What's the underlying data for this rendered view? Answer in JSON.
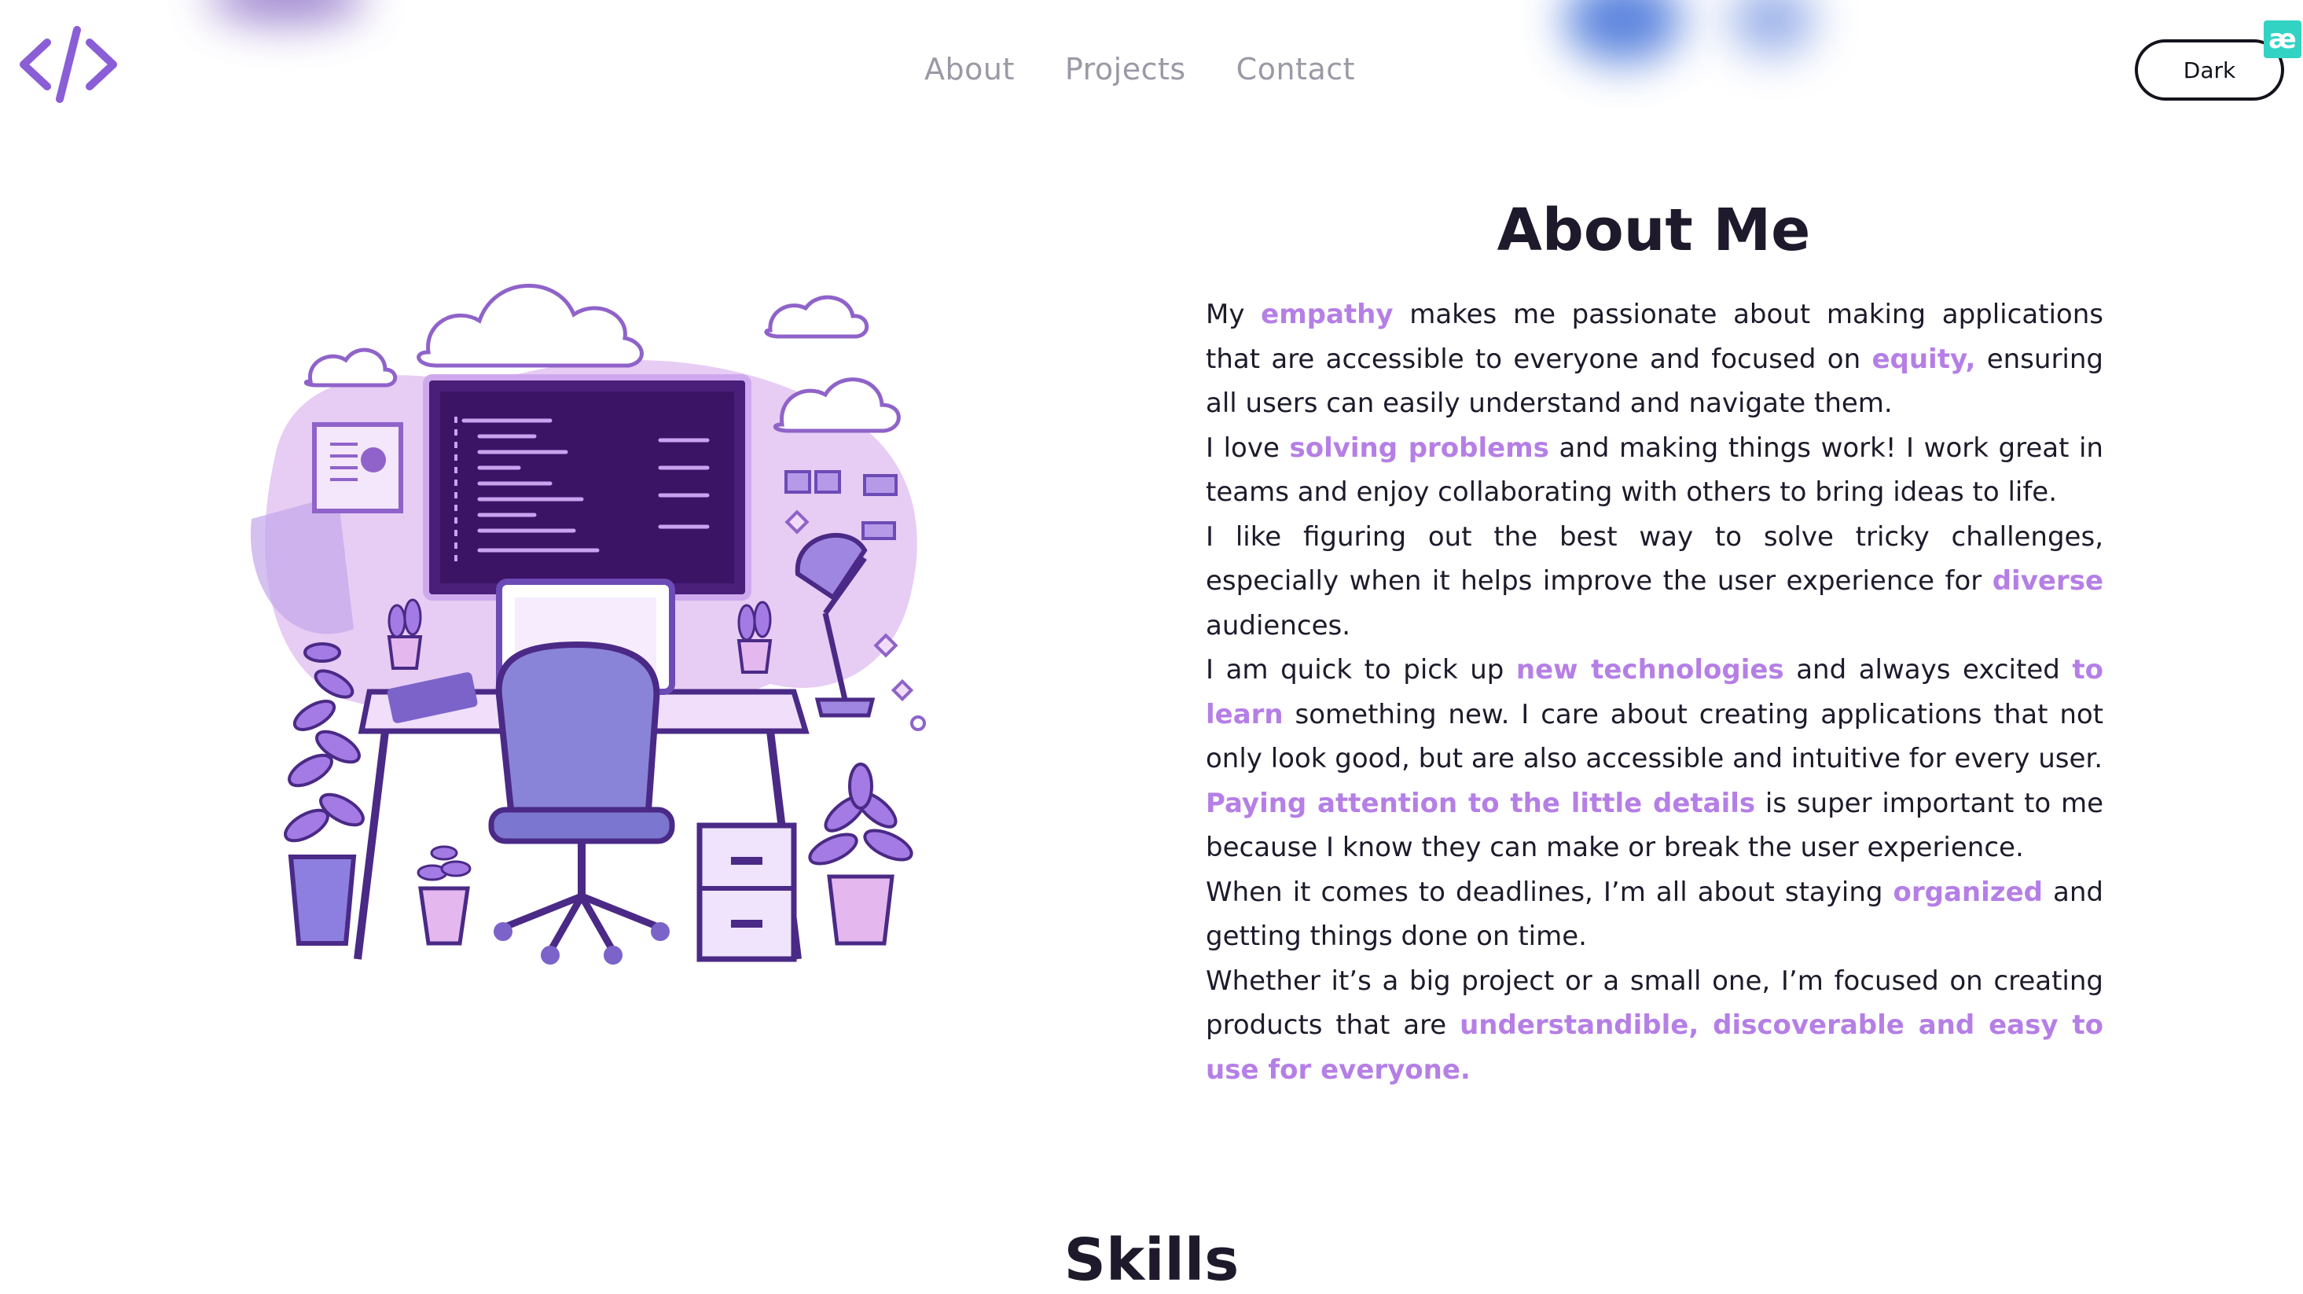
{
  "nav": {
    "links": [
      "About",
      "Projects",
      "Contact"
    ]
  },
  "theme_toggle": {
    "label": "Dark"
  },
  "badge": {
    "text": "æ"
  },
  "about": {
    "title": "About Me",
    "paragraphs": [
      [
        {
          "t": "My "
        },
        {
          "t": "empathy",
          "h": true
        },
        {
          "t": " makes me passionate about making applications that are accessible to everyone and focused on "
        },
        {
          "t": "equity,",
          "h": true
        },
        {
          "t": " ensuring all users can easily understand and navigate them."
        }
      ],
      [
        {
          "t": "I love "
        },
        {
          "t": "solving problems",
          "h": true
        },
        {
          "t": " and making things work! I work great in teams and enjoy collaborating with others to bring ideas to life."
        }
      ],
      [
        {
          "t": "I like figuring out the best way to solve tricky challenges, especially when it helps improve the user experience for "
        },
        {
          "t": "diverse",
          "h": true
        },
        {
          "t": " audiences."
        }
      ],
      [
        {
          "t": "I am quick to pick up "
        },
        {
          "t": "new technologies",
          "h": true
        },
        {
          "t": " and always excited "
        },
        {
          "t": "to learn",
          "h": true
        },
        {
          "t": " something new. I care about creating applications that not only look good, but are also accessible and intuitive for every user."
        }
      ],
      [
        {
          "t": "Paying attention to the little details",
          "h": true
        },
        {
          "t": " is super important to me because I know they can make or break the user experience."
        }
      ],
      [
        {
          "t": "When it comes to deadlines, I’m all about staying "
        },
        {
          "t": "organized",
          "h": true
        },
        {
          "t": " and getting things done on time."
        }
      ],
      [
        {
          "t": "Whether it’s a big project or a small one, I’m focused on creating products that are "
        },
        {
          "t": "understandible, discoverable and easy to use for everyone.",
          "h": true
        }
      ]
    ]
  },
  "skills": {
    "title": "Skills"
  },
  "colors": {
    "accent": "#b57fe6",
    "logo": "#8a5ed6",
    "text": "#1e1a2b",
    "nav": "#9a9aa6",
    "badge": "#32d3c2"
  },
  "icons": {
    "logo": "code-brackets-icon"
  }
}
